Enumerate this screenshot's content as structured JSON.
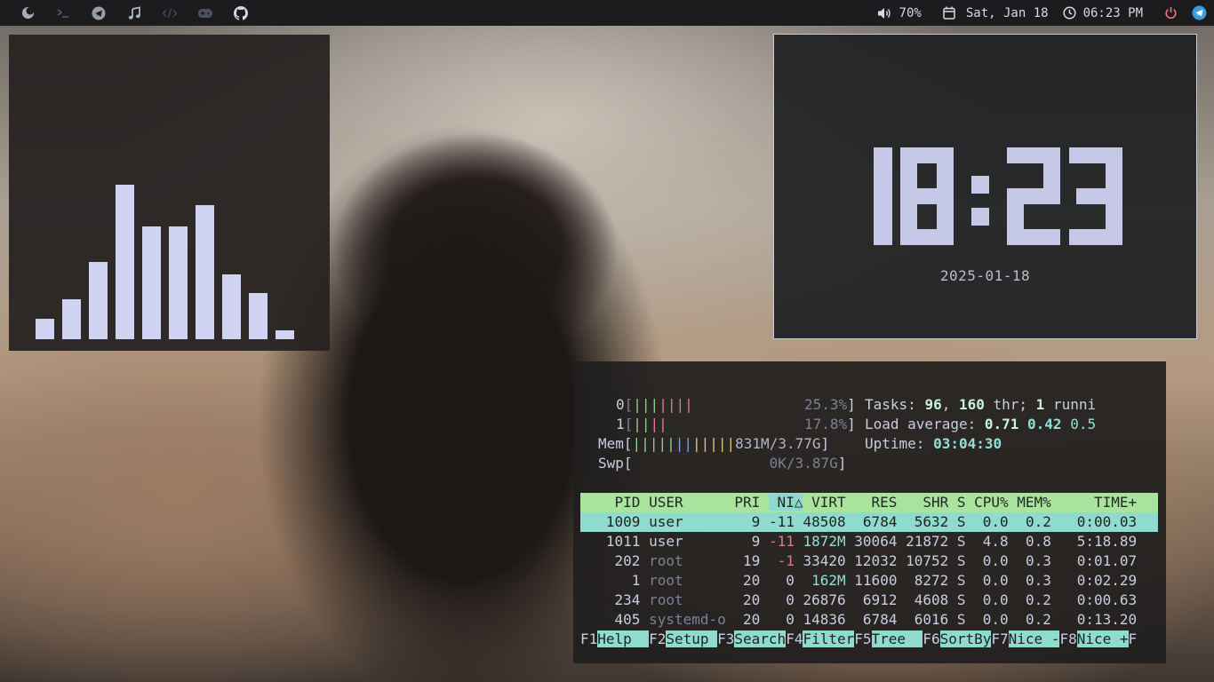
{
  "topbar": {
    "left_icons": [
      "moon-icon",
      "terminal-icon",
      "telegram-icon",
      "music-icon",
      "code-icon",
      "gamepad-icon",
      "github-icon"
    ],
    "volume": "70%",
    "date": "Sat, Jan 18",
    "time": "06:23 PM",
    "right_icons": [
      "volume-icon",
      "calendar-icon",
      "clock-icon",
      "power-icon",
      "telegram-icon"
    ]
  },
  "visualizer": {
    "levels": [
      0.13,
      0.26,
      0.5,
      1.0,
      0.73,
      0.73,
      0.87,
      0.42,
      0.3,
      0.06
    ]
  },
  "clock": {
    "time": "18:23",
    "date": "2025-01-18"
  },
  "htop": {
    "cpu0_label": "0",
    "cpu0_pct": "25.3%",
    "cpu1_label": "1",
    "cpu1_pct": "17.8%",
    "mem_label": "Mem",
    "mem_value": "831M/3.77G",
    "swp_label": "Swp",
    "swp_value": "0K/3.87G",
    "tasks_label": "Tasks: ",
    "tasks_count": "96",
    "threads_count": "160",
    "threads_label": " thr; ",
    "running_count": "1",
    "running_label": " runni",
    "load_label": "Load average: ",
    "load1": "0.71",
    "load5": "0.42",
    "load15": "0.5",
    "uptime_label": "Uptime: ",
    "uptime": "03:04:30",
    "headers": {
      "pid": "PID",
      "user": "USER",
      "pri": "PRI",
      "ni": "NI△",
      "virt": "VIRT",
      "res": "RES",
      "shr": "SHR",
      "s": "S",
      "cpu": "CPU%",
      "mem": "MEM%",
      "time": "TIME+"
    },
    "rows": [
      {
        "pid": "1009",
        "user": "user",
        "pri": "9",
        "ni": "-11",
        "virt": "48508",
        "res": "6784",
        "shr": "5632",
        "s": "S",
        "cpu": "0.0",
        "mem": "0.2",
        "time": "0:00.03"
      },
      {
        "pid": "1011",
        "user": "user",
        "pri": "9",
        "ni": "-11",
        "virt": "1872M",
        "res": "30064",
        "shr": "21872",
        "s": "S",
        "cpu": "4.8",
        "mem": "0.8",
        "time": "5:18.89"
      },
      {
        "pid": "202",
        "user": "root",
        "pri": "19",
        "ni": "-1",
        "virt": "33420",
        "res": "12032",
        "shr": "10752",
        "s": "S",
        "cpu": "0.0",
        "mem": "0.3",
        "time": "0:01.07"
      },
      {
        "pid": "1",
        "user": "root",
        "pri": "20",
        "ni": "0",
        "virt": "162M",
        "res": "11600",
        "shr": "8272",
        "s": "S",
        "cpu": "0.0",
        "mem": "0.3",
        "time": "0:02.29"
      },
      {
        "pid": "234",
        "user": "root",
        "pri": "20",
        "ni": "0",
        "virt": "26876",
        "res": "6912",
        "shr": "4608",
        "s": "S",
        "cpu": "0.0",
        "mem": "0.2",
        "time": "0:00.63"
      },
      {
        "pid": "405",
        "user": "systemd-o",
        "pri": "20",
        "ni": "0",
        "virt": "14836",
        "res": "6784",
        "shr": "6016",
        "s": "S",
        "cpu": "0.0",
        "mem": "0.2",
        "time": "0:13.20"
      }
    ],
    "fkeys": [
      {
        "key": "F1",
        "label": "Help  "
      },
      {
        "key": "F2",
        "label": "Setup "
      },
      {
        "key": "F3",
        "label": "Search"
      },
      {
        "key": "F4",
        "label": "Filter"
      },
      {
        "key": "F5",
        "label": "Tree  "
      },
      {
        "key": "F6",
        "label": "SortBy"
      },
      {
        "key": "F7",
        "label": "Nice -"
      },
      {
        "key": "F8",
        "label": "Nice +"
      },
      {
        "key": "F",
        "label": ""
      }
    ]
  }
}
